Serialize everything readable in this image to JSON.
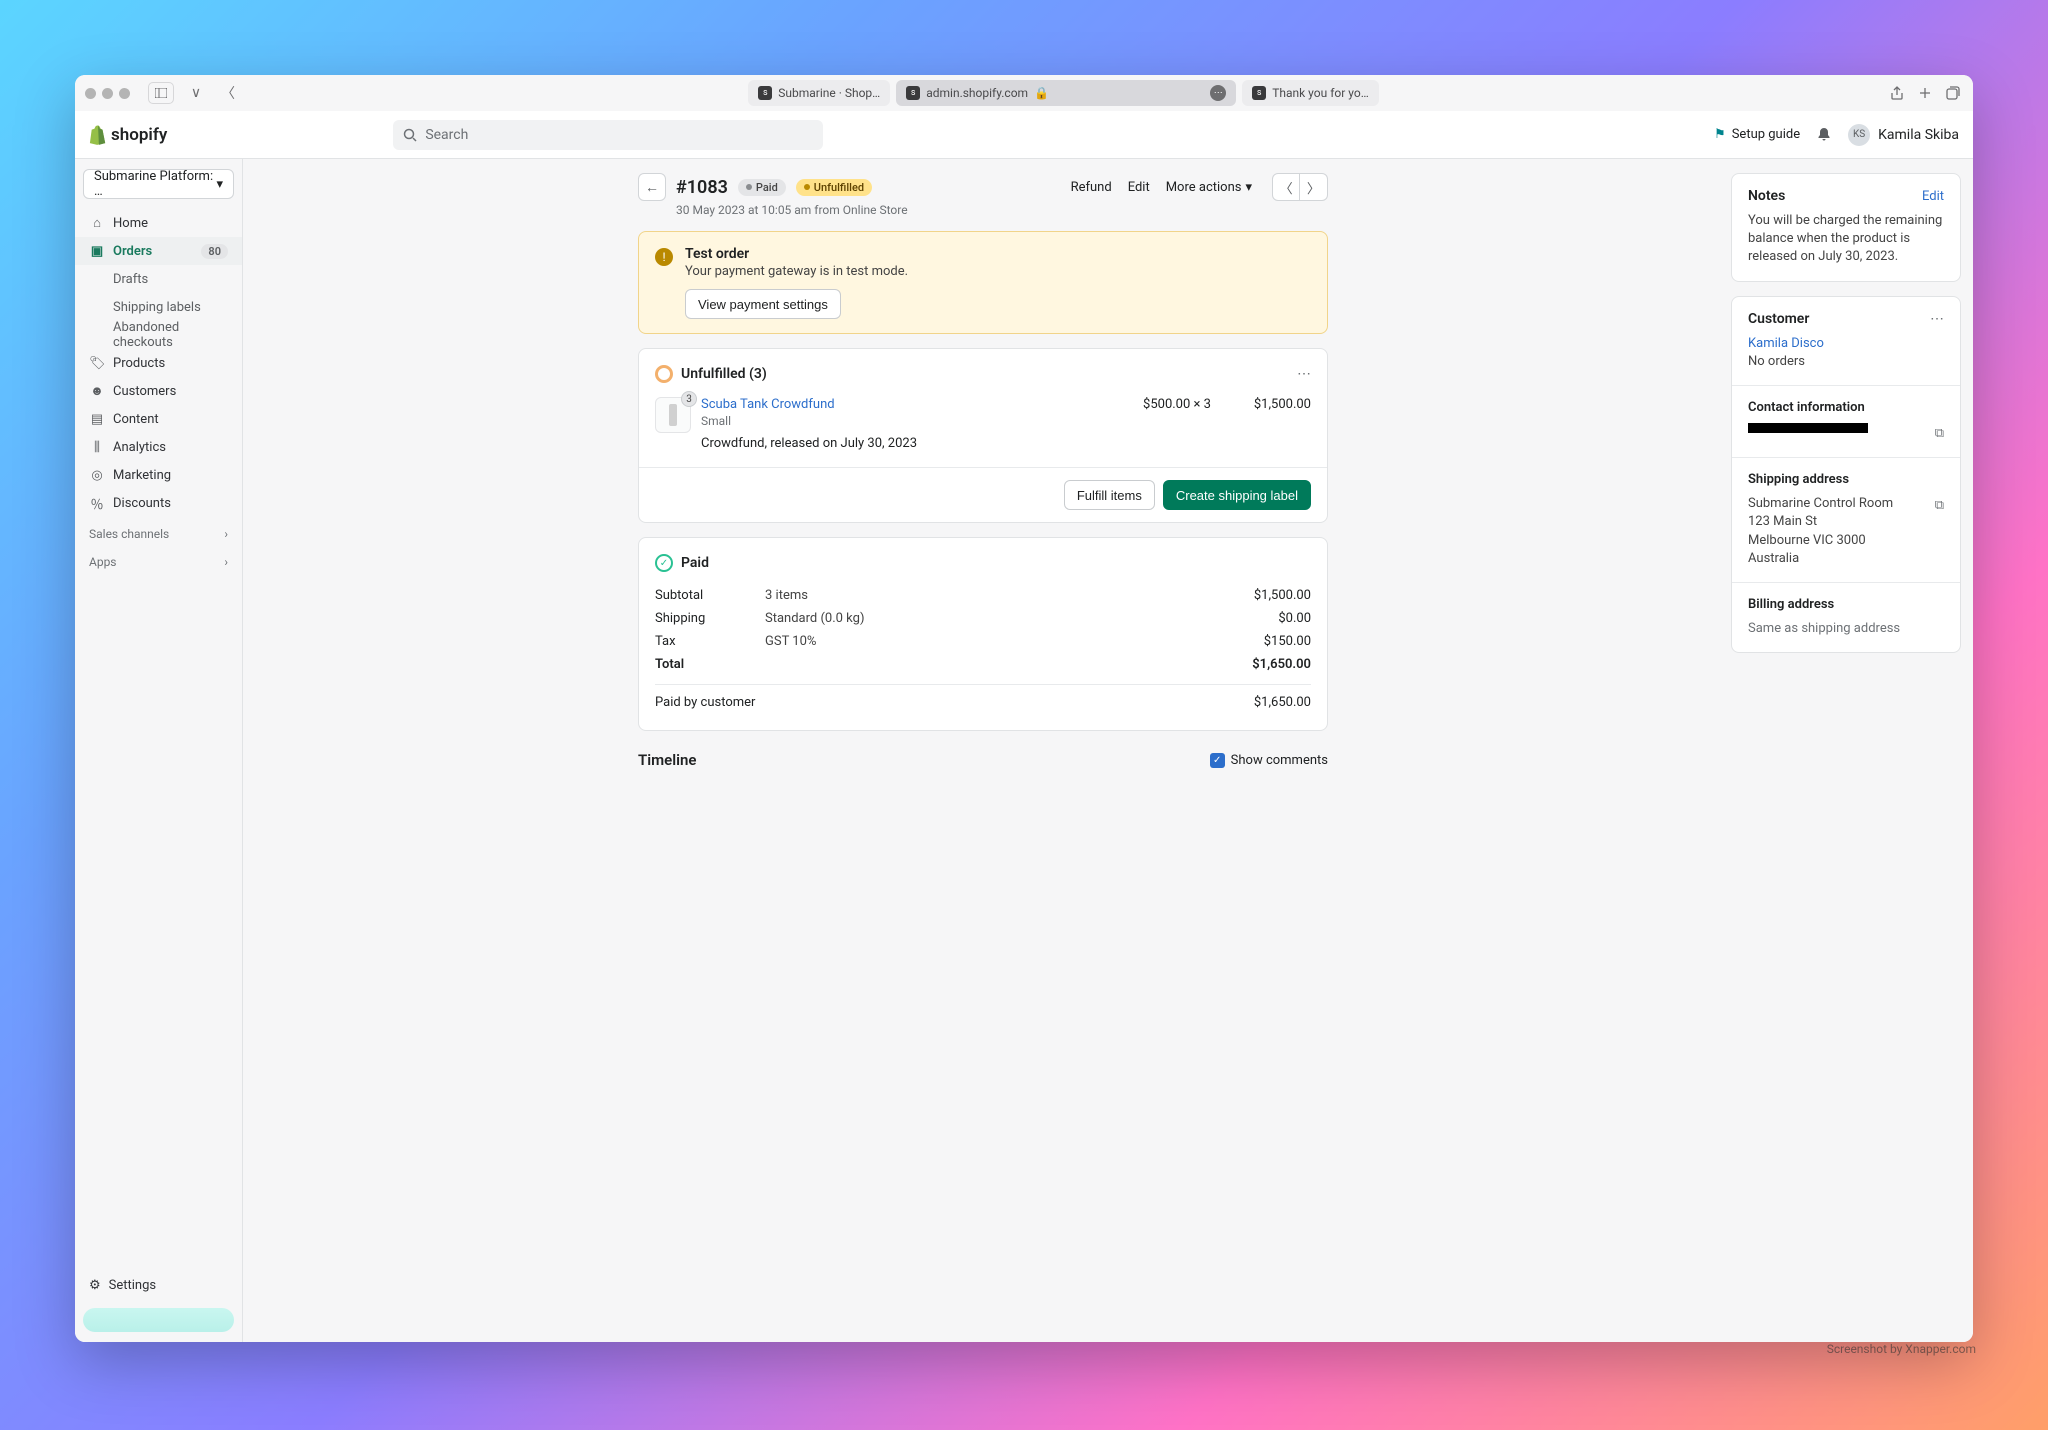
{
  "browser": {
    "tabs": [
      {
        "title": "Submarine · Shop…"
      },
      {
        "title": "admin.shopify.com"
      },
      {
        "title": "Thank you for yo…"
      }
    ]
  },
  "app": {
    "brand": "shopify",
    "search_placeholder": "Search",
    "setup_guide": "Setup guide",
    "user_initials": "KS",
    "user_name": "Kamila Skiba"
  },
  "sidebar": {
    "store": "Submarine Platform: …",
    "items": [
      "Home",
      "Orders",
      "Products",
      "Customers",
      "Content",
      "Analytics",
      "Marketing",
      "Discounts"
    ],
    "orders_count": "80",
    "sub": [
      "Drafts",
      "Shipping labels",
      "Abandoned checkouts"
    ],
    "section1": "Sales channels",
    "section2": "Apps",
    "settings": "Settings"
  },
  "order": {
    "title": "#1083",
    "paid_badge": "Paid",
    "fulfill_badge": "Unfulfilled",
    "actions": {
      "refund": "Refund",
      "edit": "Edit",
      "more": "More actions"
    },
    "subtitle": "30 May 2023 at 10:05 am from Online Store"
  },
  "banner": {
    "title": "Test order",
    "body": "Your payment gateway is in test mode.",
    "cta": "View payment settings"
  },
  "fulfill": {
    "heading": "Unfulfilled (3)",
    "item": {
      "qty": "3",
      "name": "Scuba Tank Crowdfund",
      "variant": "Small",
      "release": "Crowdfund, released on July 30, 2023",
      "unit_price": "$500.00 × 3",
      "line_total": "$1,500.00"
    },
    "btn_fulfill": "Fulfill items",
    "btn_label": "Create shipping label"
  },
  "payment": {
    "heading": "Paid",
    "rows": [
      {
        "label": "Subtotal",
        "detail": "3 items",
        "amount": "$1,500.00"
      },
      {
        "label": "Shipping",
        "detail": "Standard (0.0 kg)",
        "amount": "$0.00"
      },
      {
        "label": "Tax",
        "detail": "GST 10%",
        "amount": "$150.00"
      },
      {
        "label": "Total",
        "detail": "",
        "amount": "$1,650.00"
      }
    ],
    "paid_by": {
      "label": "Paid by customer",
      "amount": "$1,650.00"
    }
  },
  "timeline": {
    "title": "Timeline",
    "show_comments": "Show comments"
  },
  "notes": {
    "heading": "Notes",
    "edit": "Edit",
    "body": "You will be charged the remaining balance when the product is released on July 30, 2023."
  },
  "customer": {
    "heading": "Customer",
    "name": "Kamila Disco",
    "orders": "No orders",
    "contact_heading": "Contact information",
    "shipping_heading": "Shipping address",
    "shipping": [
      "Submarine Control Room",
      "123 Main St",
      "Melbourne VIC 3000",
      "Australia"
    ],
    "billing_heading": "Billing address",
    "billing": "Same as shipping address"
  },
  "watermark": "Screenshot by Xnapper.com"
}
